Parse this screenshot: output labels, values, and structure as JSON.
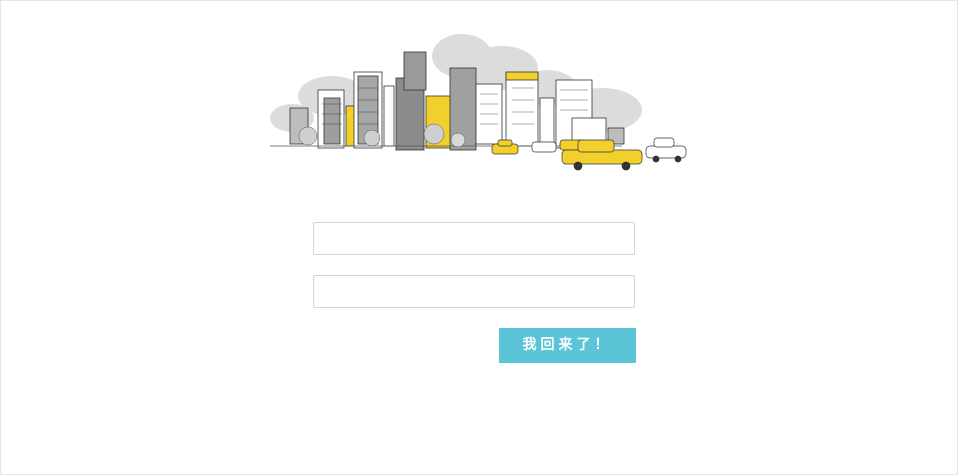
{
  "login_form": {
    "username_value": "",
    "username_placeholder": "",
    "password_value": "",
    "password_placeholder": "",
    "submit_label": "我回来了！"
  },
  "illustration": {
    "subject": "city-skyline-with-taxis",
    "accent_color": "#f1cf2c",
    "line_color": "#333333",
    "cloud_color": "#d8d8d8"
  },
  "colors": {
    "button": "#5bc4d6",
    "field_border": "#d4d4d4",
    "page_border": "#e6e6e6"
  }
}
